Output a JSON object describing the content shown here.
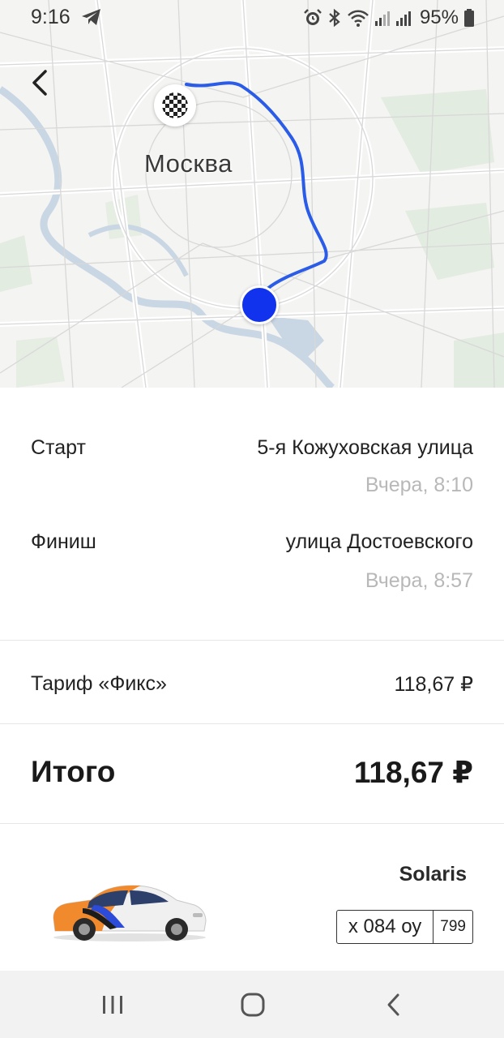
{
  "status_bar": {
    "time": "9:16",
    "battery": "95%"
  },
  "map": {
    "city_label": "Москва",
    "route_color": "#2a5ce8",
    "start_marker_color": "#1133ee"
  },
  "trip": {
    "start": {
      "label": "Старт",
      "address": "5-я Кожуховская улица",
      "time": "Вчера, 8:10"
    },
    "finish": {
      "label": "Финиш",
      "address": "улица Достоевского",
      "time": "Вчера, 8:57"
    }
  },
  "tariff": {
    "label": "Тариф «Фикс»",
    "price": "118,67 ₽"
  },
  "total": {
    "label": "Итого",
    "price": "118,67 ₽"
  },
  "car": {
    "model": "Solaris",
    "plate_number": "х 084 оу",
    "plate_region": "799"
  },
  "icons": {
    "back": "chevron-left-icon",
    "finish": "checkered-flag-icon",
    "nav_recents": "recents-icon",
    "nav_home": "home-icon",
    "nav_back": "nav-back-icon"
  }
}
